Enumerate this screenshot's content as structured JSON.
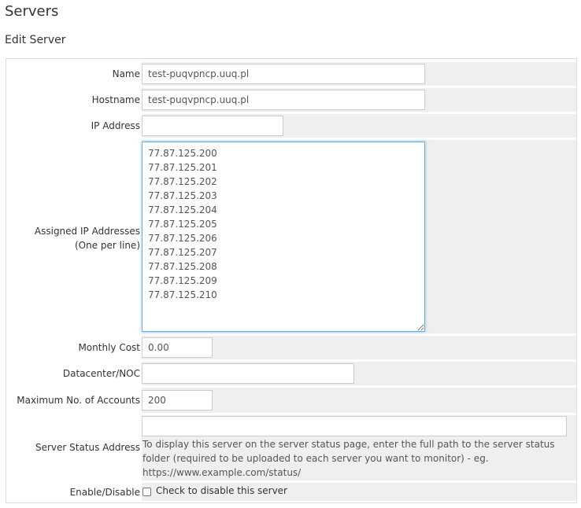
{
  "page": {
    "title": "Servers",
    "subtitle": "Edit Server"
  },
  "form": {
    "name": {
      "label": "Name",
      "value": "test-puqvpncp.uuq.pl"
    },
    "hostname": {
      "label": "Hostname",
      "value": "test-puqvpncp.uuq.pl"
    },
    "ip_address": {
      "label": "IP Address",
      "value": ""
    },
    "assigned_ips": {
      "label_line1": "Assigned IP Addresses",
      "label_line2": "(One per line)",
      "value": "77.87.125.200\n77.87.125.201\n77.87.125.202\n77.87.125.203\n77.87.125.204\n77.87.125.205\n77.87.125.206\n77.87.125.207\n77.87.125.208\n77.87.125.209\n77.87.125.210"
    },
    "monthly_cost": {
      "label": "Monthly Cost",
      "value": "0.00"
    },
    "datacenter": {
      "label": "Datacenter/NOC",
      "value": ""
    },
    "max_accounts": {
      "label": "Maximum No. of Accounts",
      "value": "200"
    },
    "status_address": {
      "label": "Server Status Address",
      "value": "",
      "help": "To display this server on the server status page, enter the full path to the server status folder (required to be uploaded to each server you want to monitor) - eg. https://www.example.com/status/"
    },
    "enable_disable": {
      "label": "Enable/Disable",
      "checkbox_label": "Check to disable this server",
      "checked": false
    }
  }
}
